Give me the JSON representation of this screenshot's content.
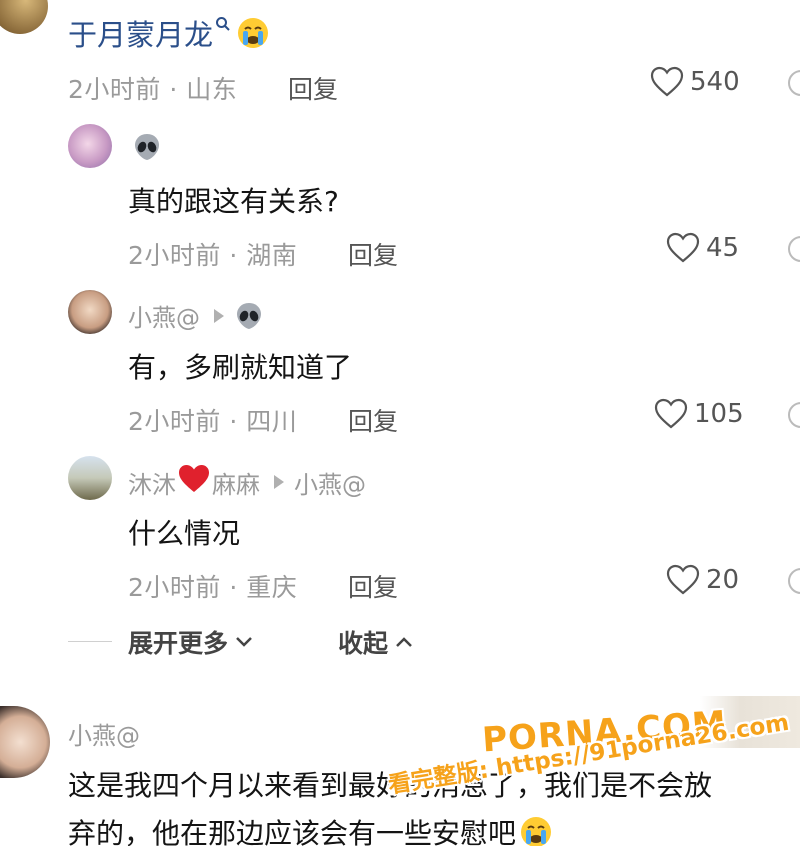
{
  "top_comment": {
    "username": "于月蒙月龙",
    "meta": "2小时前 · 山东",
    "reply_label": "回复",
    "likes": "540"
  },
  "replies": [
    {
      "text": "真的跟这有关系?",
      "meta": "2小时前 · 湖南",
      "reply_label": "回复",
      "likes": "45"
    },
    {
      "username": "小燕@",
      "text": "有，多刷就知道了",
      "meta": "2小时前 · 四川",
      "reply_label": "回复",
      "likes": "105"
    },
    {
      "username_prefix": "沐沐",
      "username_suffix": "麻麻",
      "reply_to": "小燕@",
      "text": "什么情况",
      "meta": "2小时前 · 重庆",
      "reply_label": "回复",
      "likes": "20"
    }
  ],
  "expand_more": "展开更多",
  "collapse": "收起",
  "bottom_comment": {
    "username": "小燕@",
    "line1": "这是我四个月以来看到最好的消息了，我们是不会放",
    "line2": "弃的，他在那边应该会有一些安慰吧"
  },
  "watermark": {
    "brand": "PORNA.COM",
    "line": "看完整版: https://91porna26.com"
  },
  "colors": {
    "username_blue": "#2b4f8a",
    "meta_gray": "#9a9a9a",
    "text_dark": "#141414",
    "watermark_orange": "#f6a21a"
  }
}
